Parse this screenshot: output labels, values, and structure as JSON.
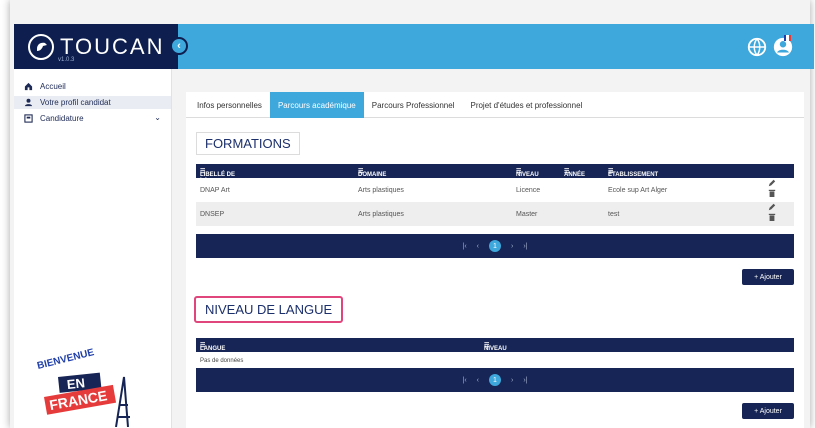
{
  "brand": {
    "name": "TOUCAN",
    "version": "v1.0.3"
  },
  "sidebar": {
    "items": [
      {
        "label": "Accueil",
        "icon": "home-icon"
      },
      {
        "label": "Votre profil candidat",
        "icon": "user-icon"
      },
      {
        "label": "Candidature",
        "icon": "application-icon"
      }
    ],
    "badge": {
      "line1": "BIENVENUE",
      "line2": "EN",
      "line3": "FRANCE"
    }
  },
  "tabs": [
    {
      "label": "Infos personnelles",
      "active": false
    },
    {
      "label": "Parcours académique",
      "active": true
    },
    {
      "label": "Parcours Professionnel",
      "active": false
    },
    {
      "label": "Projet d'études et professionnel",
      "active": false
    }
  ],
  "formations": {
    "title": "FORMATIONS",
    "headers": {
      "libelle": "LIBELLÉ DE LA FORMATION",
      "domaine": "DOMAINE",
      "niveau": "NIVEAU",
      "annee": "ANNÉE",
      "etablissement": "ETABLISSEMENT"
    },
    "rows": [
      {
        "libelle": "DNAP Art",
        "domaine": "Arts plastiques",
        "niveau": "Licence",
        "annee": "",
        "etablissement": "Ecole sup Art Alger"
      },
      {
        "libelle": "DNSEP",
        "domaine": "Arts plastiques",
        "niveau": "Master",
        "annee": "",
        "etablissement": "test"
      }
    ],
    "pager": {
      "first": "|‹",
      "prev": "‹",
      "page": "1",
      "next": "›",
      "last": "›|"
    },
    "add_label": "+ Ajouter"
  },
  "langue": {
    "title": "NIVEAU DE LANGUE",
    "headers": {
      "langue": "LANGUE",
      "niveau": "NIVEAU"
    },
    "empty": "Pas de données",
    "pager": {
      "first": "|‹",
      "prev": "‹",
      "page": "1",
      "next": "›",
      "last": "›|"
    },
    "add_label": "+ Ajouter"
  },
  "colors": {
    "navy": "#162555",
    "accent": "#3ea7dc",
    "highlight": "#e0457b"
  }
}
